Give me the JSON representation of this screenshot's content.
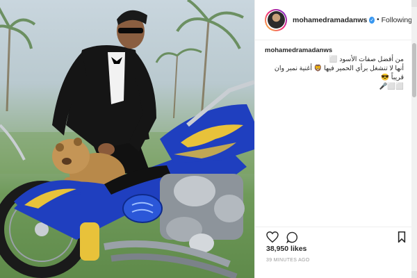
{
  "post": {
    "username": "mohamedramadanws",
    "follow_state": "Following",
    "separator": "•",
    "caption": {
      "user": "mohamedramadanws",
      "line1": "من أفضل صفات الأسود ⬜",
      "line2": "أنها لا تنشغل برأي الحمير فيها 🦁 أغنية نمبر وان قريباً 😎",
      "line3": "⬜⬜🎤"
    },
    "likes": "38,950 likes",
    "time": "39 MINUTES AGO"
  },
  "icons": {
    "verified": "verified-badge-icon",
    "like": "heart-icon",
    "comment": "comment-icon",
    "save": "bookmark-icon"
  },
  "colors": {
    "verified": "#3897f0",
    "motorcycle": "#1f3fbf",
    "flames": "#e8c23a"
  }
}
